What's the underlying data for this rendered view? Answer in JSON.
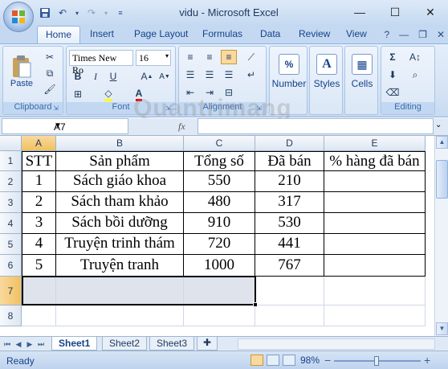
{
  "window": {
    "title": "vidu - Microsoft Excel",
    "buttons": {
      "minimize": "—",
      "maximize": "☐",
      "close": "✕"
    }
  },
  "quick_access": {
    "icons": [
      "save-icon",
      "undo-icon",
      "redo-icon",
      "customize-icon"
    ]
  },
  "ribbon_tabs": {
    "items": [
      {
        "label": "Home",
        "active": true
      },
      {
        "label": "Insert"
      },
      {
        "label": "Page Layout"
      },
      {
        "label": "Formulas"
      },
      {
        "label": "Data"
      },
      {
        "label": "Review"
      },
      {
        "label": "View"
      }
    ]
  },
  "ribbon": {
    "clipboard": {
      "label": "Clipboard",
      "paste": "Paste"
    },
    "font": {
      "label": "Font",
      "family": "Times New Ro",
      "size": "16"
    },
    "alignment": {
      "label": "Alignment"
    },
    "number": {
      "label": "Number"
    },
    "styles": {
      "label": "Styles"
    },
    "cells": {
      "label": "Cells"
    },
    "editing": {
      "label": "Editing"
    }
  },
  "formula_bar": {
    "name_box": "A7",
    "fx": "fx",
    "content": ""
  },
  "watermark": "Quantrimang",
  "grid": {
    "columns": [
      "A",
      "B",
      "C",
      "D",
      "E"
    ],
    "rows": [
      "1",
      "2",
      "3",
      "4",
      "5",
      "6",
      "7",
      "8"
    ],
    "selected_cell": "A7",
    "header": [
      "STT",
      "Sản phẩm",
      "Tổng số",
      "Đã bán",
      "% hàng đã bán"
    ],
    "data": [
      [
        "1",
        "Sách giáo khoa",
        "550",
        "210",
        ""
      ],
      [
        "2",
        "Sách tham khảo",
        "480",
        "317",
        ""
      ],
      [
        "3",
        "Sách bồi dưỡng",
        "910",
        "530",
        ""
      ],
      [
        "4",
        "Truyện trinh thám",
        "720",
        "441",
        ""
      ],
      [
        "5",
        "Truyện tranh",
        "1000",
        "767",
        ""
      ]
    ]
  },
  "sheets": {
    "items": [
      "Sheet1",
      "Sheet2",
      "Sheet3"
    ],
    "active": "Sheet1"
  },
  "status": {
    "text": "Ready",
    "zoom": "98%",
    "zoom_value": 0.98
  }
}
